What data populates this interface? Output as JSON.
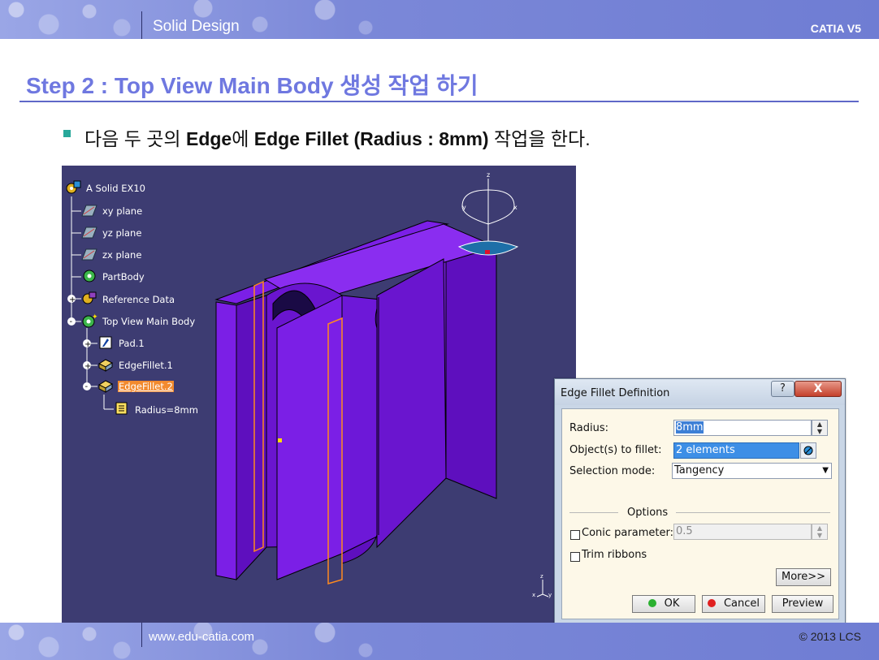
{
  "header": {
    "title": "Solid Design",
    "right_label": "CATIA V5"
  },
  "footer": {
    "url": "www.edu-catia.com",
    "copyright": "© 2013 LCS"
  },
  "step_title": "Step 2 : Top View Main Body 생성 작업 하기",
  "instruction": {
    "p1": "다음 두 곳의 ",
    "b1": "Edge",
    "p2": "에 ",
    "b2": "Edge Fillet (Radius : 8mm)",
    "p3": " 작업을 한다."
  },
  "tree": {
    "root": "A Solid EX10",
    "xy": "xy plane",
    "yz": "yz plane",
    "zx": "zx plane",
    "partbody": "PartBody",
    "reference": "Reference Data",
    "topview": "Top View Main Body",
    "pad": "Pad.1",
    "fillet1": "EdgeFillet.1",
    "fillet2": "EdgeFillet.2",
    "radius": "Radius=8mm"
  },
  "compass": {
    "z": "z",
    "x": "x",
    "y": "y"
  },
  "axis_small": {
    "z": "z",
    "x": "x",
    "y": "y"
  },
  "dialog": {
    "title": "Edge Fillet Definition",
    "help": "?",
    "close": "X",
    "radius_label": "Radius:",
    "radius_value": "8mm",
    "objects_label": "Object(s) to fillet:",
    "objects_value": "2 elements",
    "selection_label": "Selection mode:",
    "selection_value": "Tangency",
    "options_label": "Options",
    "conic_label": "Conic parameter:",
    "conic_value": "0.5",
    "trim_label": "Trim ribbons",
    "more_button": "More>>",
    "ok_button": "OK",
    "cancel_button": "Cancel",
    "preview_button": "Preview"
  },
  "colors": {
    "header_band": "#7b88d8",
    "title_text": "#6f78e0",
    "viewport_bg": "#3d3c72",
    "part_face_light": "#7b1fe6",
    "part_face_dark": "#5e0fbe",
    "edge_highlight": "#ff8a1e",
    "dialog_body": "#fdf8e8"
  }
}
